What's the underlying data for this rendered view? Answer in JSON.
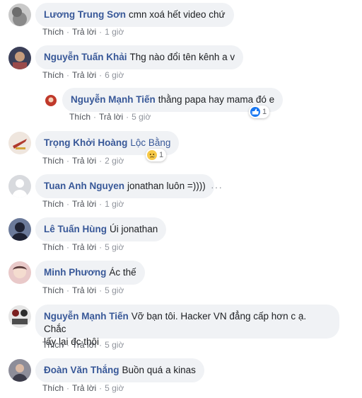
{
  "comments": [
    {
      "author": "Lương Trung Sơn",
      "text": "cmn xoá hết video chứ",
      "like": "Thích",
      "reply": "Trả lời",
      "time": "1 giờ"
    },
    {
      "author": "Nguyễn Tuấn Khải",
      "text": "Thg nào đổi tên kênh a v",
      "like": "Thích",
      "reply": "Trả lời",
      "time": "6 giờ"
    },
    {
      "author": "Nguyễn Mạnh Tiến",
      "text": "thằng papa hay mama đó e",
      "like": "Thích",
      "reply": "Trả lời",
      "time": "5 giờ",
      "reaction_count": "1",
      "reaction_icon": "like-reaction-icon"
    },
    {
      "author": "Trọng Khởi Hoàng",
      "text": "Lộc Bằng",
      "like": "Thích",
      "reply": "Trả lời",
      "time": "2 giờ",
      "reaction_count": "1",
      "reaction_icon": "sad-reaction-icon"
    },
    {
      "author": "Tuan Anh Nguyen",
      "text": "jonathan luôn =))))",
      "like": "Thích",
      "reply": "Trả lời",
      "time": "1 giờ",
      "more": "···"
    },
    {
      "author": "Lê Tuấn Hùng",
      "text": "Úi jonathan",
      "like": "Thích",
      "reply": "Trả lời",
      "time": "5 giờ"
    },
    {
      "author": "Minh Phương",
      "text": "Ác thế",
      "like": "Thích",
      "reply": "Trả lời",
      "time": "5 giờ"
    },
    {
      "author": "Nguyễn Mạnh Tiến",
      "text_line1": "Vỡ bạn tôi. Hacker VN đẳng cấp hơn c ạ. Chắc",
      "text_line2": "lấy lại đc thôi",
      "like": "Thích",
      "reply": "Trả lời",
      "time": "5 giờ"
    },
    {
      "author": "Đoàn Văn Thắng",
      "text": "Buồn quá a kinas",
      "like": "Thích",
      "reply": "Trả lời",
      "time": "5 giờ"
    }
  ],
  "colors": {
    "author": "#385898",
    "bubble": "#f0f2f5",
    "like_blue": "#1877f2",
    "sad_yellow": "#f7c948"
  }
}
